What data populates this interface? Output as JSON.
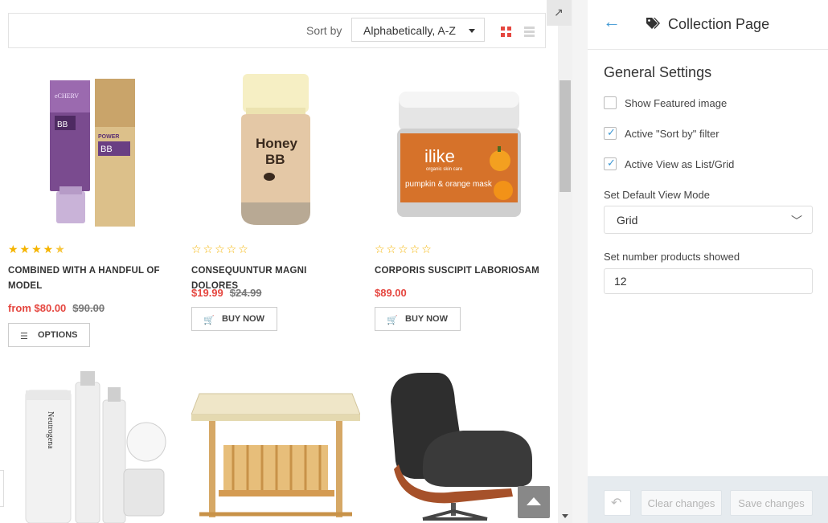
{
  "toolbar": {
    "sort_label": "Sort by",
    "sort_value": "Alphabetically, A-Z",
    "grid_icon": "grid-view-icon",
    "list_icon": "list-view-icon"
  },
  "products": [
    {
      "title": "COMBINED WITH A HANDFUL OF MODEL",
      "rating": 4.5,
      "price_prefix": "from",
      "price": "$80.00",
      "old_price": "$90.00",
      "button_label": "OPTIONS",
      "button_icon": "menu-icon"
    },
    {
      "title": "CONSEQUUNTUR MAGNI DOLORES",
      "rating": 0,
      "price": "$19.99",
      "old_price": "$24.99",
      "button_label": "BUY NOW",
      "button_icon": "cart-icon"
    },
    {
      "title": "CORPORIS SUSCIPIT LABORIOSAM",
      "rating": 0,
      "price": "$89.00",
      "old_price": "",
      "button_label": "BUY NOW",
      "button_icon": "cart-icon"
    }
  ],
  "product_images": {
    "p1_brand": "eCHERV",
    "p1_tube": "BB",
    "p1_box": "POWER",
    "p1_box_bb": "BB",
    "p2_brand": "Honey",
    "p2_bb": "BB",
    "p3_brand": "ilike",
    "p3_sub": "organic skin care",
    "p3_name": "pumpkin & orange mask",
    "p4_brand": "Neutrogena"
  },
  "sidebar": {
    "title": "Collection Page",
    "section_title": "General Settings",
    "checkboxes": [
      {
        "label": "Show Featured image",
        "checked": false
      },
      {
        "label": "Active \"Sort by\" filter",
        "checked": true
      },
      {
        "label": "Active View as List/Grid",
        "checked": true
      }
    ],
    "default_view_label": "Set Default View Mode",
    "default_view_value": "Grid",
    "number_label": "Set number products showed",
    "number_value": "12",
    "clear_label": "Clear changes",
    "save_label": "Save changes",
    "check_mark": "✓"
  },
  "colors": {
    "accent": "#3d97d3",
    "price": "#e5463f",
    "star": "#f5b400"
  }
}
